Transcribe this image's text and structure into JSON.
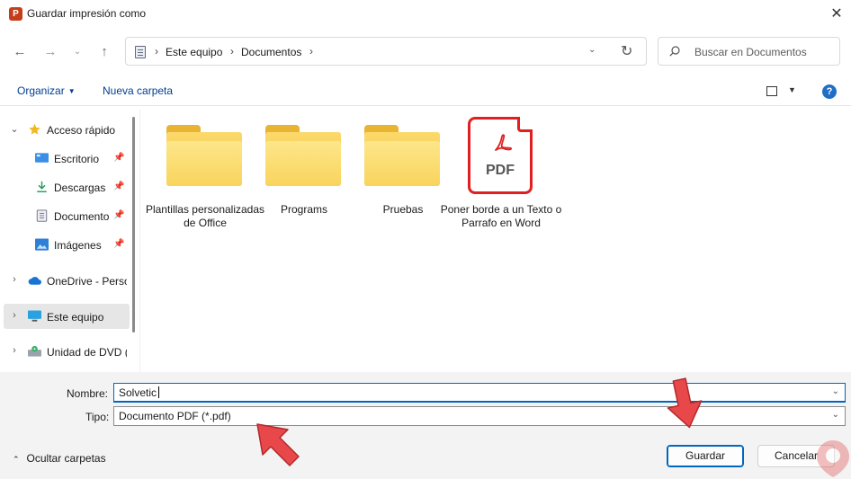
{
  "window": {
    "title": "Guardar impresión como",
    "app_icon": "P",
    "close_glyph": "✕"
  },
  "nav": {
    "back_glyph": "←",
    "forward_glyph": "→",
    "recent_glyph": "⌄",
    "up_glyph": "↑",
    "breadcrumb": [
      "Este equipo",
      "Documentos"
    ],
    "crumb_sep": "›",
    "refresh_glyph": "↻",
    "dropdown_glyph": "⌄",
    "search_placeholder": "Buscar en Documentos"
  },
  "toolbar": {
    "organize_label": "Organizar",
    "new_folder_label": "Nueva carpeta",
    "help_glyph": "?"
  },
  "sidebar": {
    "items": [
      {
        "label": "Acceso rápido",
        "icon": "star-icon"
      },
      {
        "label": "Escritorio",
        "icon": "desktop-icon"
      },
      {
        "label": "Descargas",
        "icon": "download-icon"
      },
      {
        "label": "Documentos",
        "icon": "document-icon"
      },
      {
        "label": "Imágenes",
        "icon": "images-icon"
      },
      {
        "label": "OneDrive - Personal",
        "icon": "cloud-icon"
      },
      {
        "label": "Este equipo",
        "icon": "computer-icon"
      },
      {
        "label": "Unidad de DVD (D:)",
        "icon": "dvd-icon"
      }
    ],
    "expand_glyph": "›",
    "collapse_glyph": "⌄",
    "pin_glyph": "📌"
  },
  "files": [
    {
      "name": "Plantillas personalizadas de Office",
      "type": "folder"
    },
    {
      "name": "Programs",
      "type": "folder"
    },
    {
      "name": "Pruebas",
      "type": "folder"
    },
    {
      "name": "Poner borde a un Texto o Parrafo en Word",
      "type": "pdf",
      "badge": "PDF"
    }
  ],
  "form": {
    "name_label": "Nombre:",
    "name_value": "Solvetic",
    "type_label": "Tipo:",
    "type_value": "Documento PDF (*.pdf)",
    "field_caret": "⌄"
  },
  "footer": {
    "hide_folders_label": "Ocultar carpetas",
    "hide_caret": "⌃",
    "save_label": "Guardar",
    "cancel_label": "Cancelar"
  },
  "colors": {
    "accent": "#0067c0",
    "arrow": "#e8484a",
    "pdf_red": "#e02020",
    "folder": "#f5c542"
  }
}
